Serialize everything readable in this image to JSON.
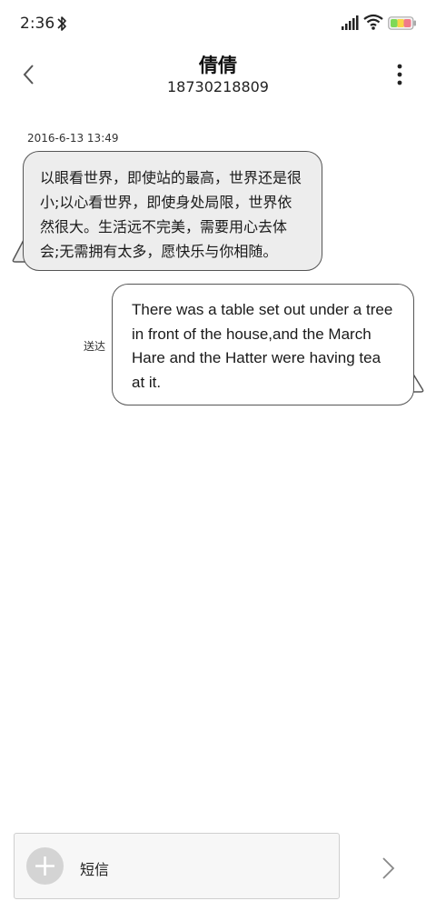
{
  "status_bar": {
    "time": "2:36",
    "icons": [
      "bluetooth-icon",
      "signal-icon",
      "wifi-icon",
      "battery-icon"
    ]
  },
  "header": {
    "contact_name": "倩倩",
    "contact_number": "18730218809",
    "back_icon": "chevron-left-icon",
    "menu_icon": "more-vertical-icon"
  },
  "messages": [
    {
      "direction": "incoming",
      "timestamp": "2016-6-13 13:49",
      "lines": [
        "以眼看世界，即使站的最高，世界还是很",
        "小;以心看世界，即使身处局限，世界依",
        "然很大。生活远不完美，需要用心去体",
        "会;无需拥有太多，愿快乐与你相随。"
      ]
    },
    {
      "direction": "outgoing",
      "status": "送达",
      "lines": [
        "There was a table set out under a tree",
        "in front of the house,and the March",
        "Hare and the Hatter were having tea",
        "at it."
      ]
    }
  ],
  "composer": {
    "placeholder": "短信",
    "add_icon": "plus-icon",
    "send_icon": "chevron-right-icon"
  },
  "colors": {
    "incoming_bubble": "#ededed",
    "outgoing_bubble": "#ffffff",
    "bubble_border": "#555555",
    "input_background": "#f7f7f7"
  }
}
